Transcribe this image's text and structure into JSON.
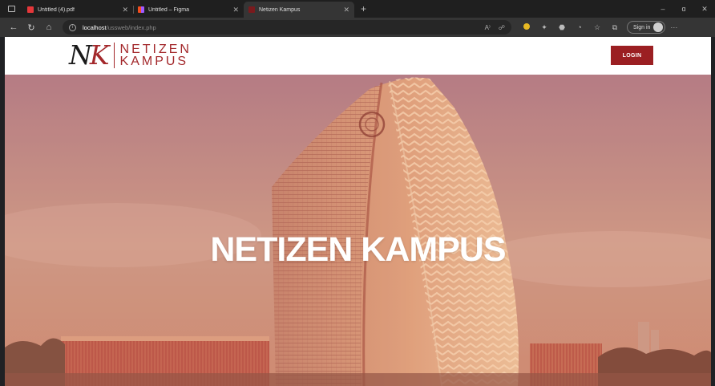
{
  "browser": {
    "tabs": [
      {
        "title": "Untitled (4).pdf",
        "favicon_color": "#e5373a"
      },
      {
        "title": "Untitled – Figma",
        "favicon_color": "#f24e1e"
      },
      {
        "title": "Netizen Kampus",
        "favicon_color": "#7a1a1d"
      }
    ],
    "new_tab": "+",
    "address": {
      "host": "localhost",
      "path": "/ussweb/index.php"
    },
    "sign_in": "Sign in",
    "window_controls": {
      "minimize": "–",
      "restore": "ɑ",
      "close": "✕"
    }
  },
  "site": {
    "logo": {
      "monogram_n": "N",
      "monogram_k": "K",
      "line1": "NETIZEN",
      "line2": "KAMPUS"
    },
    "login_label": "LOGIN",
    "hero_title": "NETIZEN KAMPUS"
  },
  "colors": {
    "brand": "#9b1f22",
    "hero_tint": "#c4887f"
  }
}
